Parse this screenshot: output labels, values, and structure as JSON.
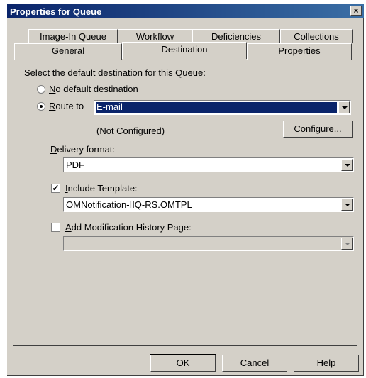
{
  "window": {
    "title": "Properties for Queue",
    "close_glyph": "×"
  },
  "tabs_back": [
    "Image-In Queue",
    "Workflow",
    "Deficiencies",
    "Collections"
  ],
  "tabs_front": [
    "General",
    "Destination",
    "Properties"
  ],
  "active_tab": "Destination",
  "destination": {
    "prompt": "Select the default destination for this Queue:",
    "no_default": {
      "mnemonic": "N",
      "rest": "o default destination",
      "selected": false
    },
    "route_to": {
      "mnemonic": "R",
      "rest": "oute to",
      "selected": true,
      "value": "E-mail"
    },
    "status": "(Not Configured)",
    "configure": {
      "mnemonic": "C",
      "rest": "onfigure..."
    },
    "delivery_format": {
      "mnemonic": "D",
      "rest": "elivery format:",
      "value": "PDF"
    },
    "include_template": {
      "mnemonic": "I",
      "rest": "nclude Template:",
      "checked": true,
      "value": "OMNotification-IIQ-RS.OMTPL"
    },
    "add_history": {
      "mnemonic": "A",
      "rest": "dd Modification History Page:",
      "checked": false,
      "value": ""
    }
  },
  "buttons": {
    "ok": "OK",
    "cancel": "Cancel",
    "help_mnemonic": "H",
    "help_rest": "elp"
  },
  "colors": {
    "title_bar": "#0a246a",
    "face": "#d4d0c8",
    "selection": "#0a246a"
  }
}
